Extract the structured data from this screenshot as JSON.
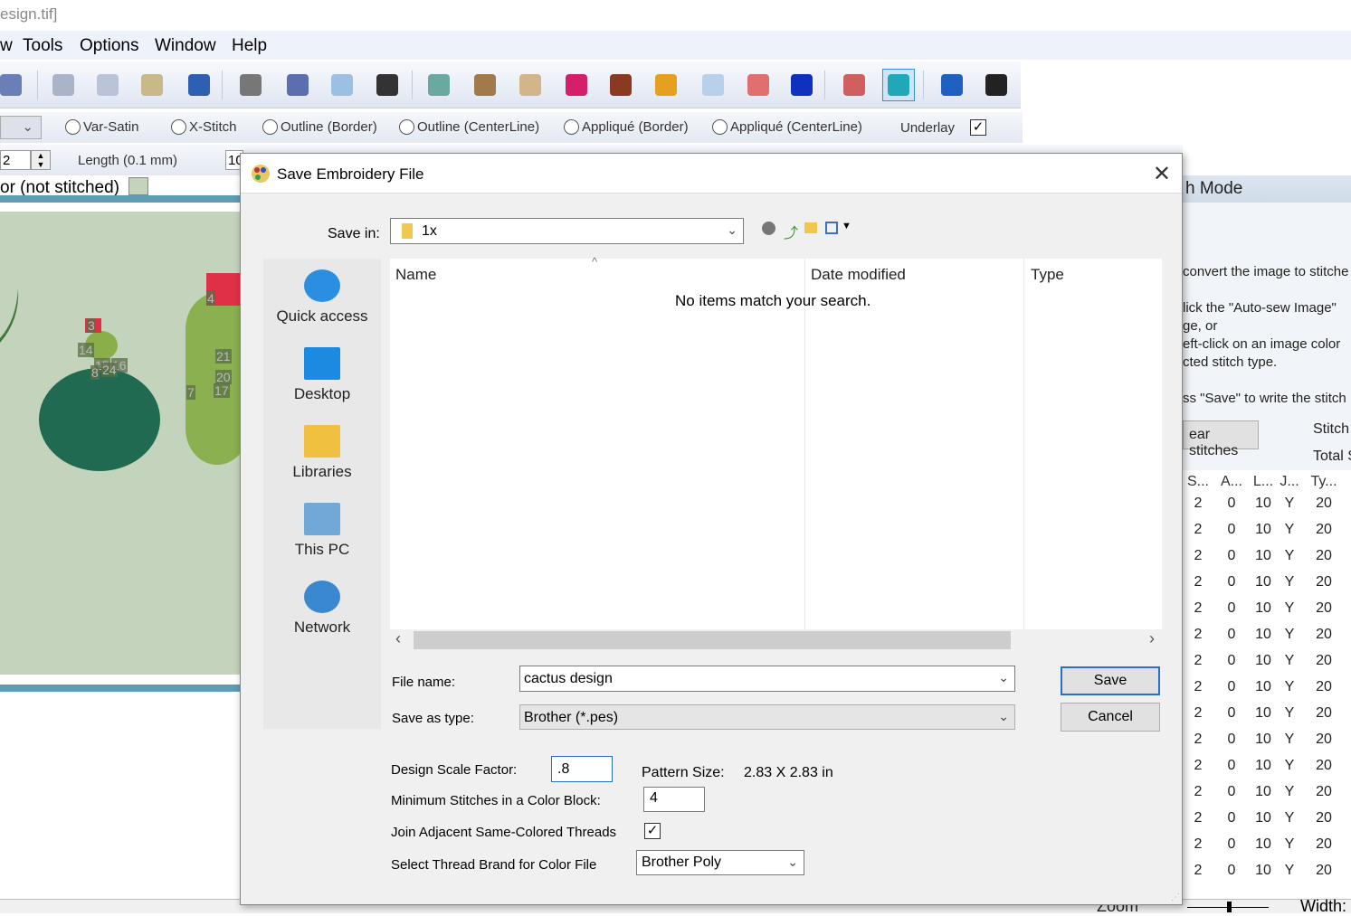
{
  "window": {
    "title": "esign.tif]"
  },
  "menu": [
    "w",
    "Tools",
    "Options",
    "Window",
    "Help"
  ],
  "toolbar_icons": [
    {
      "name": "save-as-icon",
      "color": "#6a7fb8"
    },
    {
      "name": "cut-icon",
      "color": "#aab4c8"
    },
    {
      "name": "copy-icon",
      "color": "#b9c4d8"
    },
    {
      "name": "paste-icon",
      "color": "#c9b88a"
    },
    {
      "name": "undo-icon",
      "color": "#2f5fb0"
    },
    {
      "name": "mirror-icon",
      "color": "#777"
    },
    {
      "name": "flip-icon",
      "color": "#5b6fb0"
    },
    {
      "name": "select-region-icon",
      "color": "#9cc0e4"
    },
    {
      "name": "crop-icon",
      "color": "#333"
    },
    {
      "name": "portrait-icon",
      "color": "#6aa9a0"
    },
    {
      "name": "magic-wand-icon",
      "color": "#a07a4a"
    },
    {
      "name": "palette-icon",
      "color": "#d2b58a"
    },
    {
      "name": "color-list-icon",
      "color": "#d4206a"
    },
    {
      "name": "brush-icon",
      "color": "#8a3a20"
    },
    {
      "name": "pencil-icon",
      "color": "#e6a020"
    },
    {
      "name": "fill-icon",
      "color": "#b8d0ea"
    },
    {
      "name": "eraser-icon",
      "color": "#e07070"
    },
    {
      "name": "shapes-icon",
      "color": "#1030c0"
    },
    {
      "name": "r-icon",
      "color": "#d06060"
    },
    {
      "name": "sew-mode-icon",
      "color": "#20a8b8"
    },
    {
      "name": "help-icon",
      "color": "#2060c0"
    },
    {
      "name": "whats-this-icon",
      "color": "#222"
    }
  ],
  "stitch_types": [
    "Var-Satin",
    "X-Stitch",
    "Outline (Border)",
    "Outline (CenterLine)",
    "Appliqué (Border)",
    "Appliqué (CenterLine)"
  ],
  "underlay": {
    "label": "Underlay",
    "checked": true
  },
  "length_row": {
    "spin_value": "2",
    "length_label": "Length (0.1 mm)",
    "length_value": "10"
  },
  "canvas": {
    "status_text": "or (not stitched)",
    "labels": [
      "3",
      "14",
      "15",
      "16",
      "8",
      "24",
      "4",
      "21",
      "20",
      "17",
      "7"
    ]
  },
  "right_panel": {
    "header": "h Mode",
    "lines": [
      "convert the image to stitche",
      "lick the \"Auto-sew Image\"",
      "ge, or",
      "eft-click on an image color",
      "cted stitch type.",
      "ss \"Save\" to write the stitch"
    ],
    "clear_button": "ear stitches",
    "stitch_label": "Stitch",
    "total_label": "Total S",
    "columns": [
      "S...",
      "A...",
      "L...",
      "J...",
      "Ty..."
    ],
    "rows": [
      [
        "2",
        "0",
        "10",
        "Y",
        "20"
      ],
      [
        "2",
        "0",
        "10",
        "Y",
        "20"
      ],
      [
        "2",
        "0",
        "10",
        "Y",
        "20"
      ],
      [
        "2",
        "0",
        "10",
        "Y",
        "20"
      ],
      [
        "2",
        "0",
        "10",
        "Y",
        "20"
      ],
      [
        "2",
        "0",
        "10",
        "Y",
        "20"
      ],
      [
        "2",
        "0",
        "10",
        "Y",
        "20"
      ],
      [
        "2",
        "0",
        "10",
        "Y",
        "20"
      ],
      [
        "2",
        "0",
        "10",
        "Y",
        "20"
      ],
      [
        "2",
        "0",
        "10",
        "Y",
        "20"
      ],
      [
        "2",
        "0",
        "10",
        "Y",
        "20"
      ],
      [
        "2",
        "0",
        "10",
        "Y",
        "20"
      ],
      [
        "2",
        "0",
        "10",
        "Y",
        "20"
      ],
      [
        "2",
        "0",
        "10",
        "Y",
        "20"
      ],
      [
        "2",
        "0",
        "10",
        "Y",
        "20"
      ]
    ],
    "zoom_label": "Zoom",
    "width_label": "Width:"
  },
  "dialog": {
    "title": "Save Embroidery File",
    "save_in_label": "Save in:",
    "save_in_value": "1x",
    "places": [
      "Quick access",
      "Desktop",
      "Libraries",
      "This PC",
      "Network"
    ],
    "columns": [
      "Name",
      "Date modified",
      "Type"
    ],
    "empty_message": "No items match your search.",
    "file_name_label": "File name:",
    "file_name_value": "cactus design",
    "save_as_type_label": "Save as type:",
    "save_as_type_value": "Brother (*.pes)",
    "save_button": "Save",
    "cancel_button": "Cancel",
    "scale_label": "Design Scale Factor:",
    "scale_value": ".8",
    "pattern_size_label": "Pattern Size:",
    "pattern_size_value": "2.83 X 2.83 in",
    "min_stitches_label": "Minimum Stitches in a Color Block:",
    "min_stitches_value": "4",
    "join_label": "Join Adjacent Same-Colored Threads",
    "join_checked": true,
    "thread_brand_label": "Select Thread Brand for Color File",
    "thread_brand_value": "Brother Poly"
  }
}
